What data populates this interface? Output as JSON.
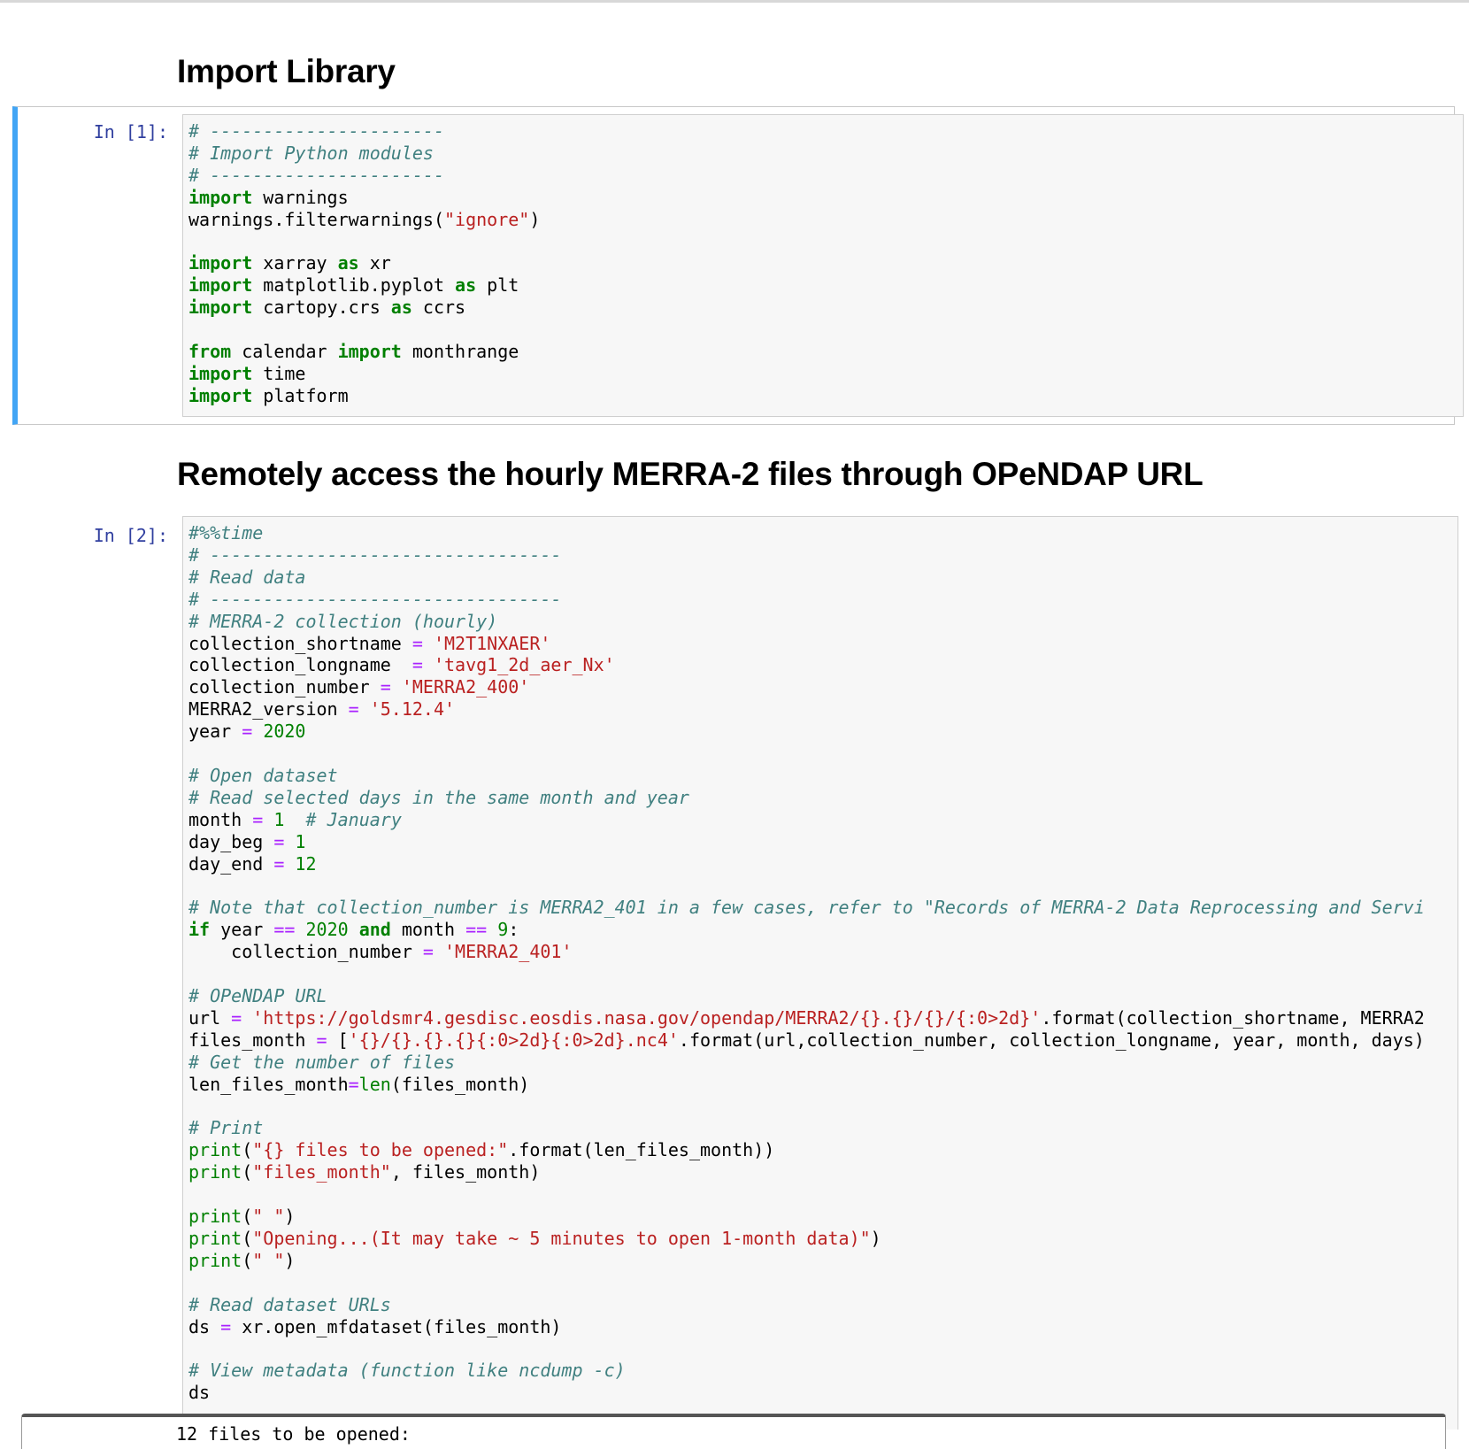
{
  "headings": {
    "import_library": "Import Library",
    "remote_access": "Remotely access the hourly MERRA-2 files through OPeNDAP URL"
  },
  "cells": [
    {
      "prompt": "In [1]:",
      "lines": [
        [
          [
            "c",
            "# ----------------------"
          ]
        ],
        [
          [
            "c",
            "# Import Python modules"
          ]
        ],
        [
          [
            "c",
            "# ----------------------"
          ]
        ],
        [
          [
            "k",
            "import"
          ],
          [
            "t",
            " warnings"
          ]
        ],
        [
          [
            "t",
            "warnings.filterwarnings("
          ],
          [
            "s",
            "\"ignore\""
          ],
          [
            "t",
            ")"
          ]
        ],
        [],
        [
          [
            "k",
            "import"
          ],
          [
            "t",
            " xarray "
          ],
          [
            "k",
            "as"
          ],
          [
            "t",
            " xr"
          ]
        ],
        [
          [
            "k",
            "import"
          ],
          [
            "t",
            " matplotlib.pyplot "
          ],
          [
            "k",
            "as"
          ],
          [
            "t",
            " plt"
          ]
        ],
        [
          [
            "k",
            "import"
          ],
          [
            "t",
            " cartopy.crs "
          ],
          [
            "k",
            "as"
          ],
          [
            "t",
            " ccrs"
          ]
        ],
        [],
        [
          [
            "k",
            "from"
          ],
          [
            "t",
            " calendar "
          ],
          [
            "k",
            "import"
          ],
          [
            "t",
            " monthrange"
          ]
        ],
        [
          [
            "k",
            "import"
          ],
          [
            "t",
            " time"
          ]
        ],
        [
          [
            "k",
            "import"
          ],
          [
            "t",
            " platform"
          ]
        ]
      ]
    },
    {
      "prompt": "In [2]:",
      "lines": [
        [
          [
            "c",
            "#%%time"
          ]
        ],
        [
          [
            "c",
            "# ---------------------------------"
          ]
        ],
        [
          [
            "c",
            "# Read data"
          ]
        ],
        [
          [
            "c",
            "# ---------------------------------"
          ]
        ],
        [
          [
            "c",
            "# MERRA-2 collection (hourly)"
          ]
        ],
        [
          [
            "t",
            "collection_shortname "
          ],
          [
            "o",
            "="
          ],
          [
            "t",
            " "
          ],
          [
            "s",
            "'M2T1NXAER'"
          ]
        ],
        [
          [
            "t",
            "collection_longname  "
          ],
          [
            "o",
            "="
          ],
          [
            "t",
            " "
          ],
          [
            "s",
            "'tavg1_2d_aer_Nx'"
          ]
        ],
        [
          [
            "t",
            "collection_number "
          ],
          [
            "o",
            "="
          ],
          [
            "t",
            " "
          ],
          [
            "s",
            "'MERRA2_400'"
          ]
        ],
        [
          [
            "t",
            "MERRA2_version "
          ],
          [
            "o",
            "="
          ],
          [
            "t",
            " "
          ],
          [
            "s",
            "'5.12.4'"
          ]
        ],
        [
          [
            "t",
            "year "
          ],
          [
            "o",
            "="
          ],
          [
            "t",
            " "
          ],
          [
            "m",
            "2020"
          ]
        ],
        [],
        [
          [
            "c",
            "# Open dataset"
          ]
        ],
        [
          [
            "c",
            "# Read selected days in the same month and year"
          ]
        ],
        [
          [
            "t",
            "month "
          ],
          [
            "o",
            "="
          ],
          [
            "t",
            " "
          ],
          [
            "m",
            "1"
          ],
          [
            "t",
            "  "
          ],
          [
            "c",
            "# January"
          ]
        ],
        [
          [
            "t",
            "day_beg "
          ],
          [
            "o",
            "="
          ],
          [
            "t",
            " "
          ],
          [
            "m",
            "1"
          ]
        ],
        [
          [
            "t",
            "day_end "
          ],
          [
            "o",
            "="
          ],
          [
            "t",
            " "
          ],
          [
            "m",
            "12"
          ]
        ],
        [],
        [
          [
            "c",
            "# Note that collection_number is MERRA2_401 in a few cases, refer to \"Records of MERRA-2 Data Reprocessing and Servi"
          ]
        ],
        [
          [
            "k",
            "if"
          ],
          [
            "t",
            " year "
          ],
          [
            "o",
            "=="
          ],
          [
            "t",
            " "
          ],
          [
            "m",
            "2020"
          ],
          [
            "t",
            " "
          ],
          [
            "k",
            "and"
          ],
          [
            "t",
            " month "
          ],
          [
            "o",
            "=="
          ],
          [
            "t",
            " "
          ],
          [
            "m",
            "9"
          ],
          [
            "t",
            ":"
          ]
        ],
        [
          [
            "t",
            "    collection_number "
          ],
          [
            "o",
            "="
          ],
          [
            "t",
            " "
          ],
          [
            "s",
            "'MERRA2_401'"
          ]
        ],
        [],
        [
          [
            "c",
            "# OPeNDAP URL"
          ]
        ],
        [
          [
            "t",
            "url "
          ],
          [
            "o",
            "="
          ],
          [
            "t",
            " "
          ],
          [
            "s",
            "'https://goldsmr4.gesdisc.eosdis.nasa.gov/opendap/MERRA2/{}.{}/{}/{:0>2d}'"
          ],
          [
            "t",
            ".format(collection_shortname, MERRA2"
          ]
        ],
        [
          [
            "t",
            "files_month "
          ],
          [
            "o",
            "="
          ],
          [
            "t",
            " ["
          ],
          [
            "s",
            "'{}/{}.{}.{}{:0>2d}{:0>2d}.nc4'"
          ],
          [
            "t",
            ".format(url,collection_number, collection_longname, year, month, days)"
          ]
        ],
        [
          [
            "c",
            "# Get the number of files"
          ]
        ],
        [
          [
            "t",
            "len_files_month"
          ],
          [
            "o",
            "="
          ],
          [
            "b",
            "len"
          ],
          [
            "t",
            "(files_month)"
          ]
        ],
        [],
        [
          [
            "c",
            "# Print"
          ]
        ],
        [
          [
            "b",
            "print"
          ],
          [
            "t",
            "("
          ],
          [
            "s",
            "\"{} files to be opened:\""
          ],
          [
            "t",
            ".format(len_files_month))"
          ]
        ],
        [
          [
            "b",
            "print"
          ],
          [
            "t",
            "("
          ],
          [
            "s",
            "\"files_month\""
          ],
          [
            "t",
            ", files_month)"
          ]
        ],
        [],
        [
          [
            "b",
            "print"
          ],
          [
            "t",
            "("
          ],
          [
            "s",
            "\" \""
          ],
          [
            "t",
            ")"
          ]
        ],
        [
          [
            "b",
            "print"
          ],
          [
            "t",
            "("
          ],
          [
            "s",
            "\"Opening...(It may take ~ 5 minutes to open 1-month data)\""
          ],
          [
            "t",
            ")"
          ]
        ],
        [
          [
            "b",
            "print"
          ],
          [
            "t",
            "("
          ],
          [
            "s",
            "\" \""
          ],
          [
            "t",
            ")"
          ]
        ],
        [],
        [
          [
            "c",
            "# Read dataset URLs"
          ]
        ],
        [
          [
            "t",
            "ds "
          ],
          [
            "o",
            "="
          ],
          [
            "t",
            " xr.open_mfdataset(files_month)"
          ]
        ],
        [],
        [
          [
            "c",
            "# View metadata (function like ncdump -c)"
          ]
        ],
        [
          [
            "t",
            "ds"
          ]
        ]
      ]
    }
  ],
  "output": {
    "first_line": "12 files to be opened:"
  }
}
